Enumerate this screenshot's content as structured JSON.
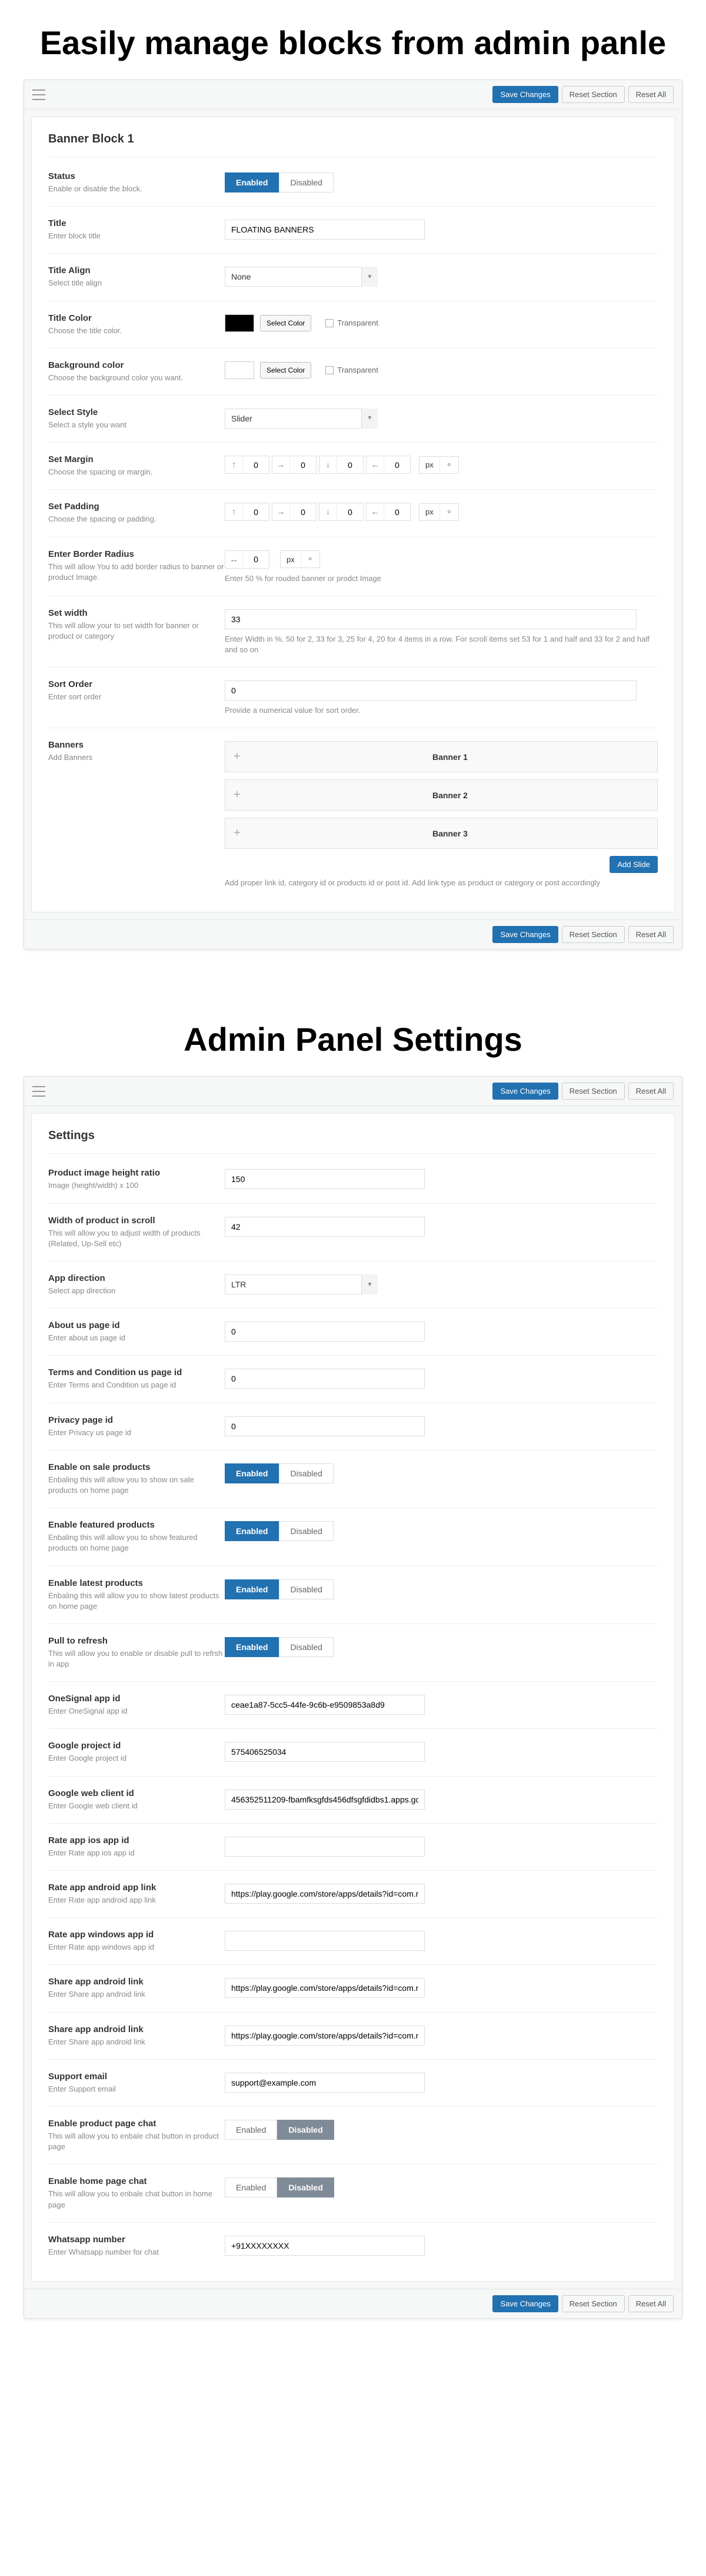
{
  "headings": {
    "blocks": "Easily manage blocks from admin panle",
    "settings": "Admin Panel Settings"
  },
  "toolbar": {
    "save": "Save Changes",
    "reset_section": "Reset Section",
    "reset_all": "Reset All"
  },
  "toggle": {
    "enabled": "Enabled",
    "disabled": "Disabled"
  },
  "common": {
    "select_color": "Select Color",
    "transparent": "Transparent",
    "px": "px",
    "add_slide": "Add Slide"
  },
  "block_panel": {
    "title": "Banner Block 1",
    "status": {
      "label": "Status",
      "desc": "Enable or disable the block."
    },
    "title_field": {
      "label": "Title",
      "desc": "Enter block title",
      "value": "FLOATING BANNERS"
    },
    "title_align": {
      "label": "Title Align",
      "desc": "Select title align",
      "value": "None"
    },
    "title_color": {
      "label": "Title Color",
      "desc": "Choose the title color."
    },
    "bg_color": {
      "label": "Background color",
      "desc": "Choose the background color you want."
    },
    "select_style": {
      "label": "Select Style",
      "desc": "Select a style you want",
      "value": "Slider"
    },
    "margin": {
      "label": "Set Margin",
      "desc": "Choose the spacing or margin.",
      "t": "0",
      "r": "0",
      "b": "0",
      "l": "0"
    },
    "padding": {
      "label": "Set Padding",
      "desc": "Choose the spacing or padding.",
      "t": "0",
      "r": "0",
      "b": "0",
      "l": "0"
    },
    "radius": {
      "label": "Enter Border Radius",
      "desc": "This will allow You to add border radius to banner or product Image.",
      "value": "0",
      "help": "Enter 50 % for rouded banner or prodct Image"
    },
    "width": {
      "label": "Set width",
      "desc": "This will allow your to set width for banner or product or category",
      "value": "33",
      "help": "Enter Width in %. 50 for 2, 33 for 3, 25 for 4, 20 for 4 items in a row. For scroll items set 53 for 1 and half and 33 for 2 and half and so on"
    },
    "sort": {
      "label": "Sort Order",
      "desc": "Enter sort order",
      "value": "0",
      "help": "Provide a numerical value for sort order."
    },
    "banners": {
      "label": "Banners",
      "desc": "Add Banners",
      "items": [
        "Banner 1",
        "Banner 2",
        "Banner 3"
      ],
      "help": "Add proper link id, category id or products id or post id. Add link type as product or category or post accordingly"
    }
  },
  "settings_panel": {
    "title": "Settings",
    "height_ratio": {
      "label": "Product image height ratio",
      "desc": "Image (height/width) x 100",
      "value": "150"
    },
    "scroll_width": {
      "label": "Width of product in scroll",
      "desc": "This will allow you to adjust width of products (Related, Up-Sell etc)",
      "value": "42"
    },
    "app_dir": {
      "label": "App direction",
      "desc": "Select app direction",
      "value": "LTR"
    },
    "about_id": {
      "label": "About us page id",
      "desc": "Enter about us page id",
      "value": "0"
    },
    "terms_id": {
      "label": "Terms and Condition us page id",
      "desc": "Enter Terms and Condition us page id",
      "value": "0"
    },
    "privacy_id": {
      "label": "Privacy page id",
      "desc": "Enter Privacy us page id",
      "value": "0"
    },
    "enable_sale": {
      "label": "Enable on sale products",
      "desc": "Enbaling this will allow you to show on sale products on home page"
    },
    "enable_featured": {
      "label": "Enable featured products",
      "desc": "Enbaling this will allow you to show featured products on home page"
    },
    "enable_latest": {
      "label": "Enable latest products",
      "desc": "Enbaling this will allow you to show latest products on home page"
    },
    "pull_refresh": {
      "label": "Pull to refresh",
      "desc": "This will allow you to enable or disable pull to refrsh in app"
    },
    "onesignal": {
      "label": "OneSignal app id",
      "desc": "Enter OneSignal app id",
      "value": "ceae1a87-5cc5-44fe-9c6b-e9509853a8d9"
    },
    "google_project": {
      "label": "Google project id",
      "desc": "Enter Google project id",
      "value": "575406525034"
    },
    "google_web_client": {
      "label": "Google web client id",
      "desc": "Enter Google web client id",
      "value": "456352511209-fbamfksgfds456dfsgfdidbs1.apps.gc"
    },
    "rate_ios": {
      "label": "Rate app ios app id",
      "desc": "Enter Rate app ios app id",
      "value": ""
    },
    "rate_android": {
      "label": "Rate app android app link",
      "desc": "Enter Rate app android app link",
      "value": "https://play.google.com/store/apps/details?id=com.n"
    },
    "rate_windows": {
      "label": "Rate app windows app id",
      "desc": "Enter Rate app windows app id",
      "value": ""
    },
    "share_android": {
      "label": "Share app android link",
      "desc": "Enter Share app android link",
      "value": "https://play.google.com/store/apps/details?id=com.n"
    },
    "share_android2": {
      "label": "Share app android link",
      "desc": "Enter Share app android link",
      "value": "https://play.google.com/store/apps/details?id=com.n"
    },
    "support_email": {
      "label": "Support email",
      "desc": "Enter Support email",
      "value": "support@example.com"
    },
    "prod_chat": {
      "label": "Enable product page chat",
      "desc": "This will allow you to enbale chat button in product page"
    },
    "home_chat": {
      "label": "Enable home page chat",
      "desc": "This will allow you to enbale chat button in home page"
    },
    "whatsapp": {
      "label": "Whatsapp number",
      "desc": "Enter Whatsapp number for chat",
      "value": "+91XXXXXXXX"
    }
  }
}
